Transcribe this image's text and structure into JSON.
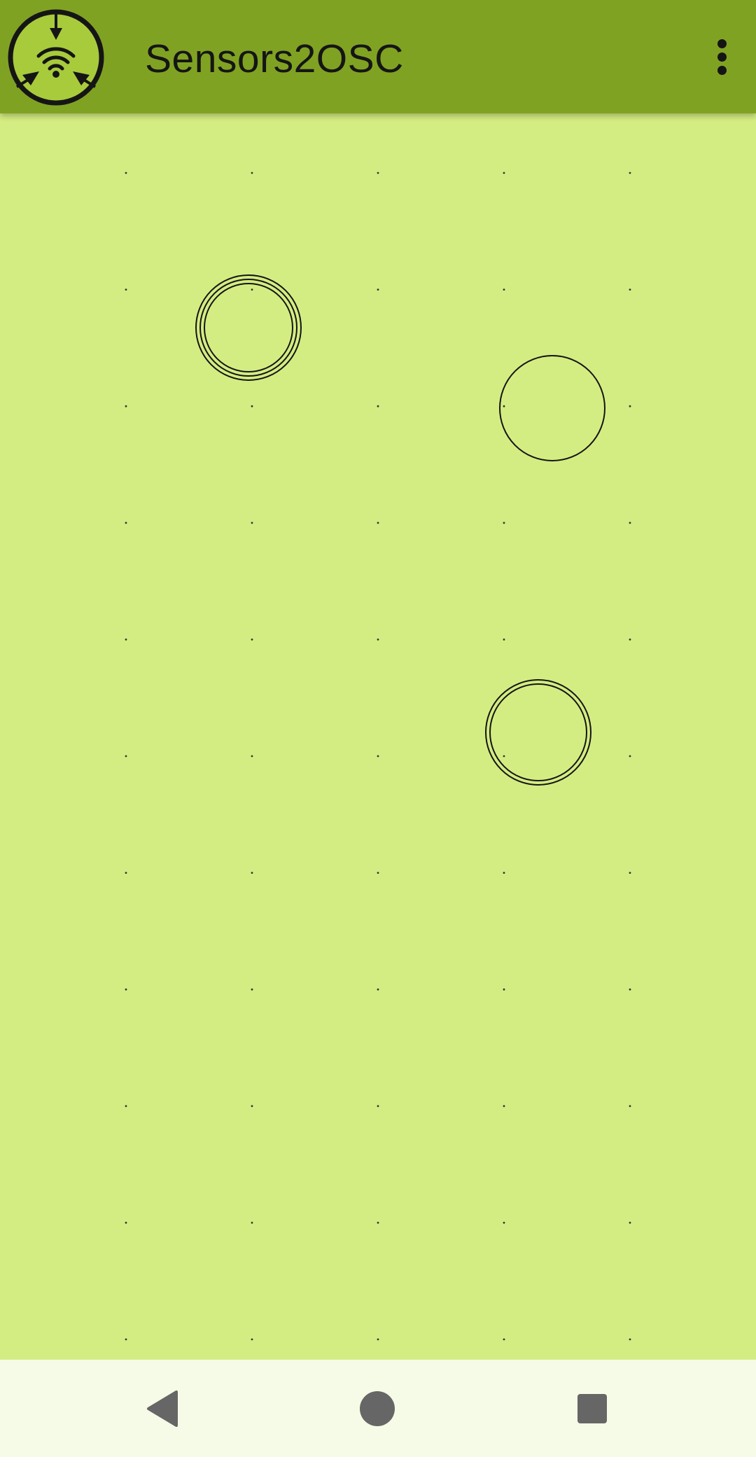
{
  "app_bar": {
    "title": "Sensors2OSC",
    "logo_icon": "sensors2osc-logo-icon",
    "menu_icon": "more-vert-icon"
  },
  "colors": {
    "app_bar": "#80a223",
    "canvas": "#d4ed82",
    "logo_fill": "#a8cb3c",
    "ink": "#151515",
    "nav_bar": "#f5fbe6",
    "nav_icon": "#666666"
  },
  "canvas": {
    "grid": {
      "columns": 5,
      "rows": 11
    },
    "touch_points": [
      {
        "name": "touch-point-1",
        "style": "triple-ring"
      },
      {
        "name": "touch-point-2",
        "style": "single-ring"
      },
      {
        "name": "touch-point-3",
        "style": "double-ring"
      }
    ]
  },
  "nav_bar": {
    "back_icon": "back-triangle-icon",
    "home_icon": "home-circle-icon",
    "recents_icon": "recents-square-icon"
  }
}
